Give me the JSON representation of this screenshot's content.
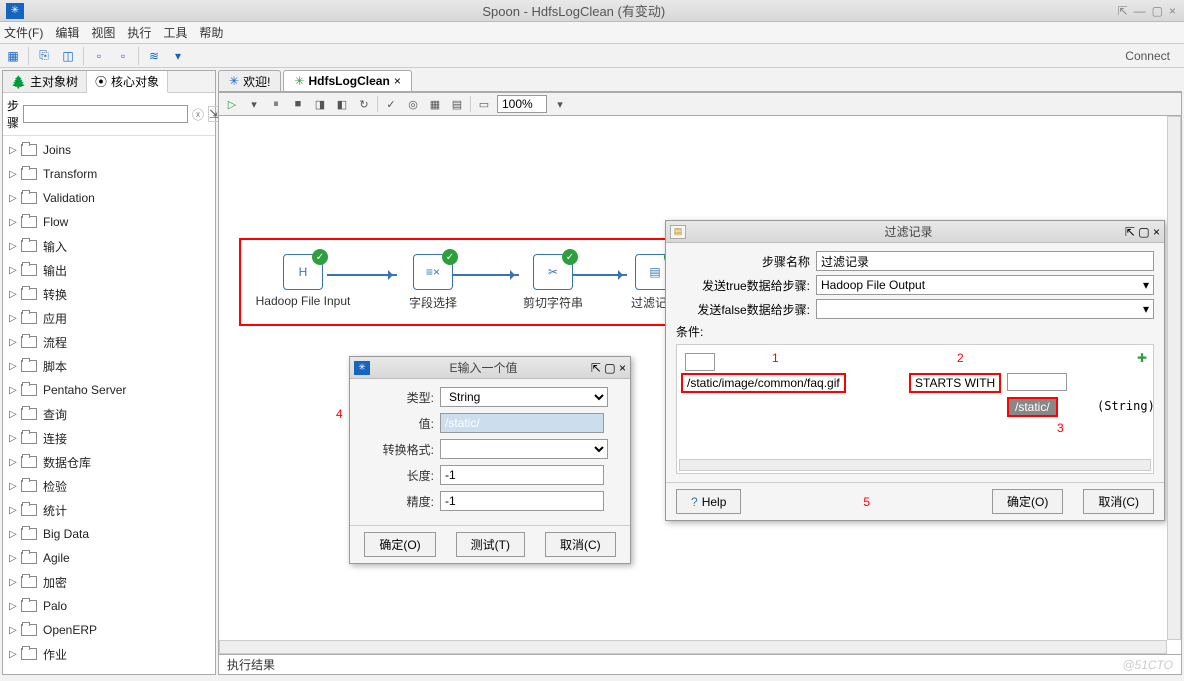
{
  "window": {
    "title": "Spoon - HdfsLogClean (有变动)"
  },
  "menubar": [
    "文件(F)",
    "编辑",
    "视图",
    "执行",
    "工具",
    "帮助"
  ],
  "toolbar": {
    "connect": "Connect"
  },
  "left": {
    "tabs": [
      {
        "icon": "tree",
        "label": "主对象树"
      },
      {
        "icon": "core",
        "label": "核心对象"
      }
    ],
    "search_label": "步骤",
    "search_placeholder": "",
    "items": [
      "Joins",
      "Transform",
      "Validation",
      "Flow",
      "输入",
      "输出",
      "转换",
      "应用",
      "流程",
      "脚本",
      "Pentaho Server",
      "查询",
      "连接",
      "数据仓库",
      "检验",
      "统计",
      "Big Data",
      "Agile",
      "加密",
      "Palo",
      "OpenERP",
      "作业"
    ]
  },
  "docs": {
    "tabs": [
      {
        "label": "欢迎!"
      },
      {
        "label": "HdfsLogClean",
        "close": "×"
      }
    ],
    "zoom": "100%"
  },
  "flow": {
    "nodes": [
      {
        "label": "Hadoop File Input",
        "icon": "H"
      },
      {
        "label": "字段选择",
        "icon": "≡×"
      },
      {
        "label": "剪切字符串",
        "icon": "✂"
      },
      {
        "label": "过滤记录",
        "icon": "▤"
      }
    ]
  },
  "dlg_value": {
    "title": "E输入一个值",
    "type_label": "类型:",
    "type_value": "String",
    "value_label": "值:",
    "value_value": "/static/",
    "format_label": "转换格式:",
    "format_value": "",
    "length_label": "长度:",
    "length_value": "-1",
    "precision_label": "精度:",
    "precision_value": "-1",
    "btn_ok": "确定(O)",
    "btn_test": "测试(T)",
    "btn_cancel": "取消(C)",
    "ann4": "4"
  },
  "dlg_filter": {
    "title": "过滤记录",
    "step_name_label": "步骤名称",
    "step_name_value": "过滤记录",
    "true_label": "发送true数据给步骤:",
    "true_value": "Hadoop File Output",
    "false_label": "发送false数据给步骤:",
    "false_value": "",
    "cond_label": "条件:",
    "cond_field": "/static/image/common/faq.gif",
    "cond_op": "STARTS WITH",
    "cond_val": "/static/",
    "cond_val_type": "(String)",
    "ann1": "1",
    "ann2": "2",
    "ann3": "3",
    "ann5": "5",
    "help": "Help",
    "btn_ok": "确定(O)",
    "btn_cancel": "取消(C)"
  },
  "results": {
    "label": "执行结果",
    "watermark": "@51CTO"
  }
}
